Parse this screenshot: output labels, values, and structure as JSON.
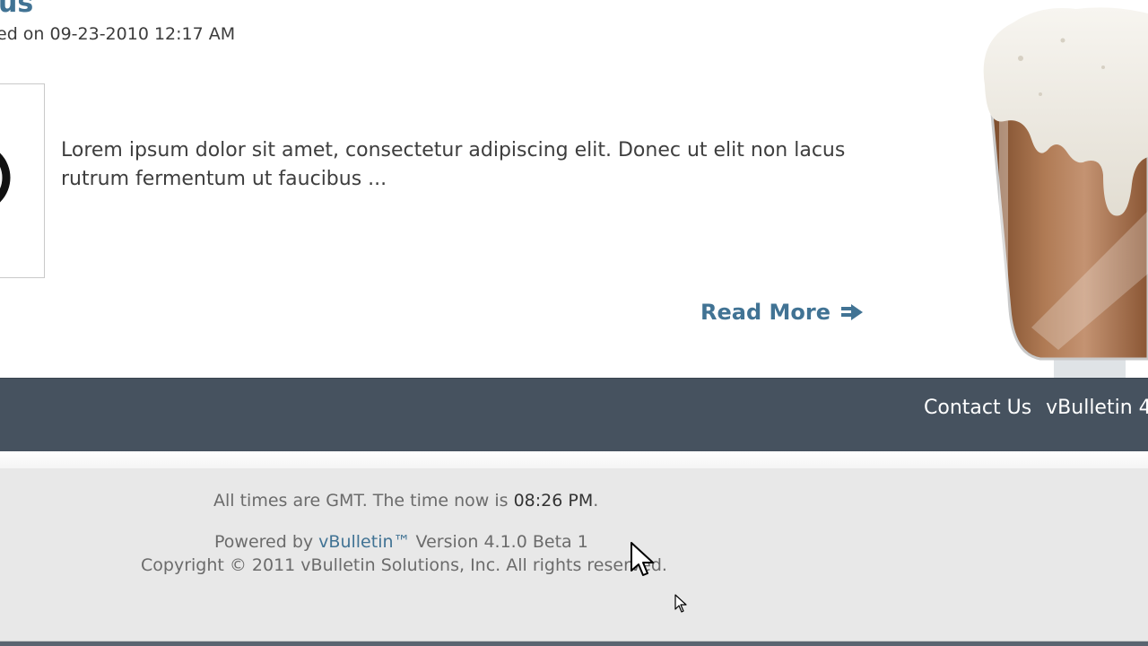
{
  "article": {
    "title": "us",
    "meta": "ed on 09-23-2010 12:17 AM",
    "body": "Lorem ipsum dolor sit amet, consectetur adipiscing elit. Donec ut elit non lacus rutrum fermentum ut faucibus ...",
    "read_more": "Read More"
  },
  "nav": {
    "links": [
      {
        "label": "Contact Us"
      },
      {
        "label": "vBulletin 4"
      }
    ]
  },
  "footer": {
    "time_prefix": "All times are GMT. The time now is ",
    "time_value": "08:26 PM",
    "time_suffix": ".",
    "powered_prefix": "Powered by ",
    "powered_link": "vBulletin™",
    "powered_suffix": " Version 4.1.0 Beta 1",
    "copyright": "Copyright © 2011 vBulletin Solutions, Inc. All rights reserved."
  },
  "colors": {
    "link_blue": "#417394",
    "nav_bg": "#46525f",
    "footer_bg": "#e8e8e8"
  },
  "icons": {
    "read_more_arrow": "arrow-right-icon",
    "mug": "root-beer-mug-icon",
    "cursor": "mouse-pointer-icon"
  }
}
